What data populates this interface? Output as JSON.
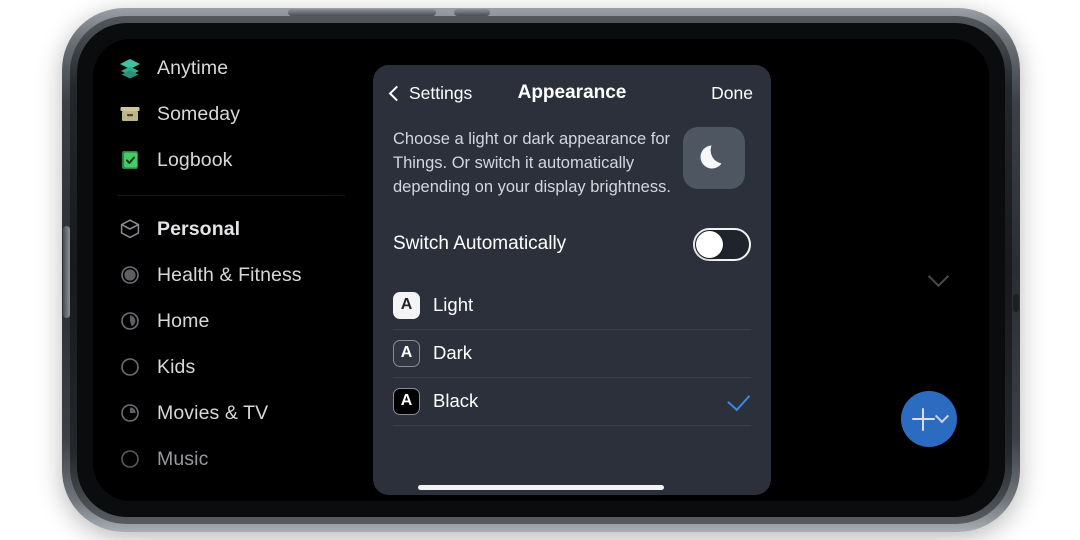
{
  "device": {
    "orientation": "landscape",
    "frame_color": "#3c4045",
    "screen_bg": "#000000"
  },
  "app": {
    "name": "Things",
    "theme": "Black",
    "sidebar": {
      "groups": [
        {
          "items": [
            {
              "label": "Anytime",
              "icon": "layers-icon",
              "icon_color": "#3ec4a0",
              "bold": false,
              "dim": false
            },
            {
              "label": "Someday",
              "icon": "box-icon",
              "icon_color": "#c7bf92",
              "bold": false,
              "dim": false
            },
            {
              "label": "Logbook",
              "icon": "logbook-check-icon",
              "icon_color": "#3cc463",
              "bold": false,
              "dim": false
            }
          ]
        },
        {
          "items": [
            {
              "label": "Personal",
              "icon": "area-cube-icon",
              "icon_color": "#8d8d92",
              "bold": true,
              "dim": false
            },
            {
              "label": "Health & Fitness",
              "icon": "project-progress-icon",
              "progress": 100,
              "icon_color": "#6e6e73",
              "bold": false,
              "dim": false
            },
            {
              "label": "Home",
              "icon": "project-progress-icon",
              "progress": 55,
              "icon_color": "#6e6e73",
              "bold": false,
              "dim": false
            },
            {
              "label": "Kids",
              "icon": "project-progress-icon",
              "progress": 0,
              "icon_color": "#6e6e73",
              "bold": false,
              "dim": false
            },
            {
              "label": "Movies & TV",
              "icon": "project-progress-icon",
              "progress": 25,
              "icon_color": "#6e6e73",
              "bold": false,
              "dim": false
            },
            {
              "label": "Music",
              "icon": "project-progress-icon",
              "progress": 0,
              "icon_color": "#5a5a5f",
              "bold": false,
              "dim": true
            }
          ]
        }
      ]
    },
    "content": {
      "collapse_chevron": "chevron-down-icon",
      "fab": {
        "label": "+",
        "icon": "plus-icon",
        "secondary_icon": "chevron-down-icon",
        "color": "#2c6cc0"
      }
    }
  },
  "sheet": {
    "nav": {
      "back_label": "Settings",
      "back_icon": "chevron-left-icon",
      "title": "Appearance",
      "done_label": "Done"
    },
    "description": "Choose a light or dark appearance for Things. Or switch it automatically depending on your display brightness.",
    "hero_icon": "moon-crescent-icon",
    "switch": {
      "label": "Switch Automatically",
      "state": "off"
    },
    "options": [
      {
        "label": "Light",
        "badge": "A",
        "badge_style": "light",
        "selected": false
      },
      {
        "label": "Dark",
        "badge": "A",
        "badge_style": "dark",
        "selected": false
      },
      {
        "label": "Black",
        "badge": "A",
        "badge_style": "black",
        "selected": true
      }
    ],
    "selected_color": "#3d87e8",
    "panel_color": "#2b303a"
  },
  "home_indicator": true
}
